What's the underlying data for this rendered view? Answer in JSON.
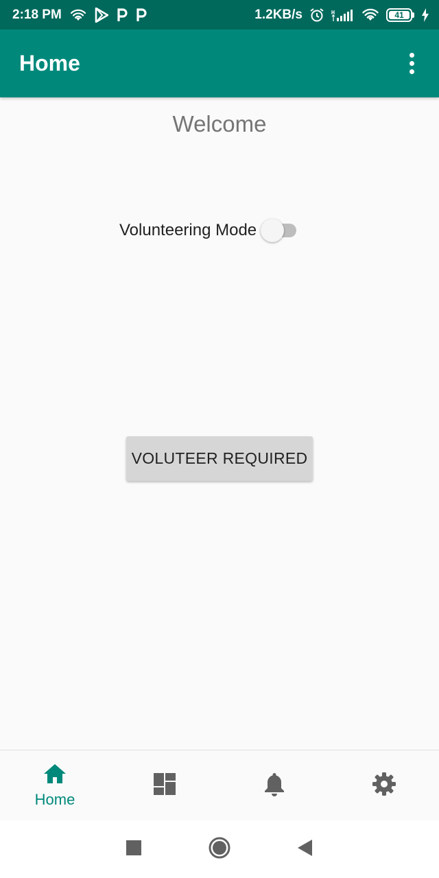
{
  "status_bar": {
    "time": "2:18 PM",
    "net_speed": "1.2KB/s",
    "battery": "41",
    "icons_left": [
      "wifi-icon",
      "play-store-icon",
      "p-app-icon",
      "p-app-icon"
    ],
    "icons_right": [
      "alarm-icon",
      "signal-icon",
      "wifi-icon",
      "battery-icon",
      "charging-icon"
    ]
  },
  "app_bar": {
    "title": "Home",
    "overflow_icon": "more-vert-icon"
  },
  "main": {
    "welcome": "Welcome",
    "mode_label": "Volunteering Mode",
    "mode_on": false,
    "button_label": "VOLUTEER REQUIRED"
  },
  "bottom_nav": {
    "items": [
      {
        "icon": "home-icon",
        "label": "Home",
        "active": true
      },
      {
        "icon": "dashboard-icon"
      },
      {
        "icon": "bell-icon"
      },
      {
        "icon": "settings-icon"
      }
    ]
  },
  "colors": {
    "primary": "#00897b",
    "primary_dark": "#00695c",
    "background": "#fafafa",
    "inactive_icon": "#616161"
  }
}
